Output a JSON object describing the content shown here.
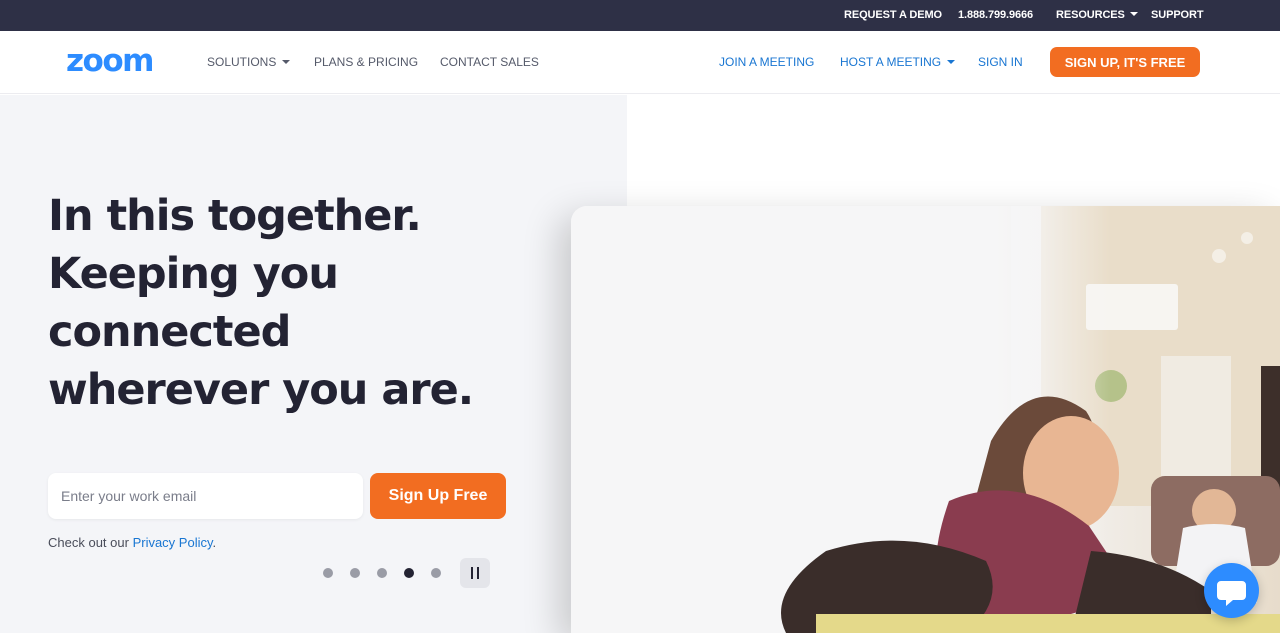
{
  "topbar": {
    "request_demo": "REQUEST A DEMO",
    "phone": "1.888.799.9666",
    "resources": "RESOURCES",
    "support": "SUPPORT"
  },
  "nav": {
    "logo_text": "zoom",
    "solutions": "SOLUTIONS",
    "plans": "PLANS & PRICING",
    "contact": "CONTACT SALES",
    "join": "JOIN A MEETING",
    "host": "HOST A MEETING",
    "signin": "SIGN IN",
    "signup": "SIGN UP, IT'S FREE"
  },
  "hero": {
    "headline": [
      "In this together.",
      "Keeping you",
      "connected",
      "wherever you are."
    ],
    "email_placeholder": "Enter your work email",
    "signup_button": "Sign Up Free",
    "privacy_prefix": "Check out our",
    "privacy_link": "Privacy Policy",
    "privacy_suffix": ".",
    "carousel_count": 5,
    "carousel_active": 3,
    "pause_icon": "pause-icon"
  },
  "chat": {
    "icon": "chat-icon"
  },
  "colors": {
    "topbar_bg": "#2e3046",
    "brand_blue": "#2d8cff",
    "link_blue": "#1976d2",
    "accent_orange": "#f26d21",
    "headline": "#232333",
    "hero_bg": "#f4f5f8"
  }
}
